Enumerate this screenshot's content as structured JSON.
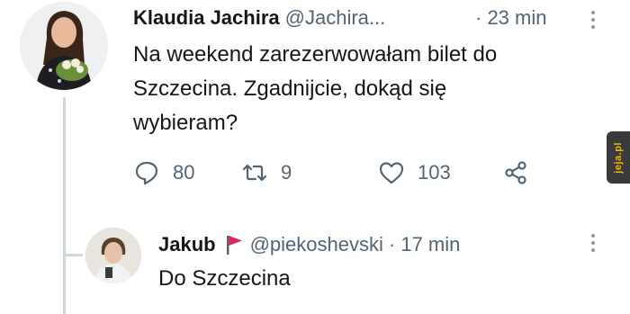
{
  "tweet": {
    "author_name": "Klaudia Jachira",
    "handle": "@Jachira...",
    "time": "· 23 min",
    "text_line1": "Na weekend zarezerwowałam bilet do",
    "text_line2": "Szczecina. Zgadnijcie, dokąd się",
    "text_line3": "wybieram?",
    "actions": {
      "reply_count": "80",
      "retweet_count": "9",
      "like_count": "103"
    }
  },
  "reply": {
    "author_name": "Jakub",
    "handle": "@piekoshevski",
    "time": "· 17 min",
    "text": "Do Szczecina"
  },
  "icons": {
    "reply": "comment-icon",
    "retweet": "retweet-icon",
    "like": "heart-icon",
    "share": "share-icon",
    "more": "more-vertical-icon",
    "flag": "red-flag-icon"
  },
  "colors": {
    "text": "#14171a",
    "secondary": "#536471",
    "thread_line": "#cfd9de",
    "flag": "#e0245e"
  },
  "watermark": {
    "text": "jeja.pl"
  }
}
